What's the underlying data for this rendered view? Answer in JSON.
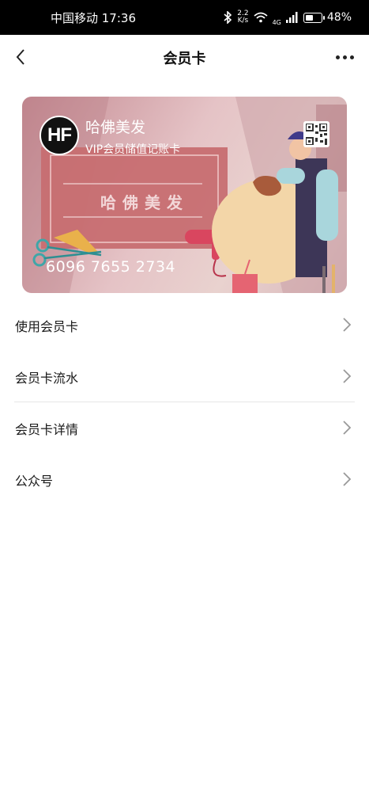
{
  "status_bar": {
    "carrier_time": "中国移动 17:36",
    "speed_value": "2.2",
    "speed_unit": "K/s",
    "network": "4G",
    "battery_percent": "48%",
    "battery_level": 0.48
  },
  "nav": {
    "title": "会员卡",
    "back_icon": "chevron-left-icon",
    "more_icon": "more-dots-icon"
  },
  "card": {
    "logo_text": "HF",
    "shop_name": "哈佛美发",
    "card_type": "VIP会员储值记账卡",
    "inner_brand": "哈佛美发",
    "card_number": "6096 7655 2734",
    "qr_icon": "qr-code-icon"
  },
  "menu": {
    "items": [
      {
        "label": "使用会员卡"
      },
      {
        "label": "会员卡流水"
      },
      {
        "label": "会员卡详情"
      },
      {
        "label": "公众号"
      }
    ]
  }
}
